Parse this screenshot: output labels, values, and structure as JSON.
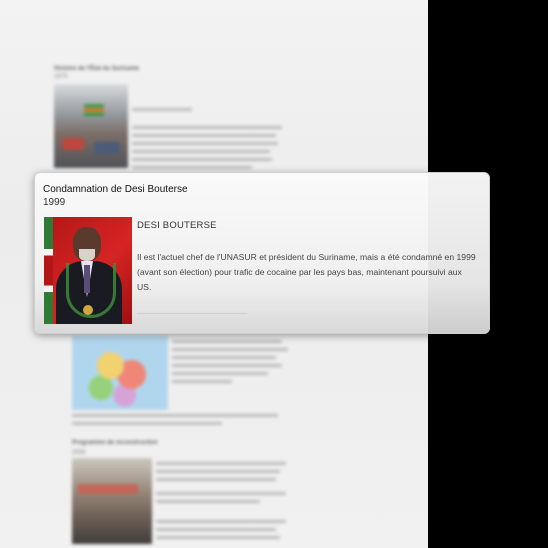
{
  "background_page": {
    "top_heading": "Histoire de l'État du Suriname",
    "top_year": "1975",
    "mid_heading": "Programme de reconstruction",
    "mid_year": "2008"
  },
  "event_card": {
    "title": "Condamnation de Desi Bouterse",
    "year": "1999",
    "name": "DESI BOUTERSE",
    "description": "Il est l'actuel chef de l'UNASUR et président du Suriname, mais a été condamné en 1999 (avant son élection) pour trafic de cocaine par les pays bas, maintenant poursuivi aux US."
  },
  "colors": {
    "page_background": "#efefef",
    "right_panel": "#000000",
    "card_background": "#f5f5f5"
  }
}
